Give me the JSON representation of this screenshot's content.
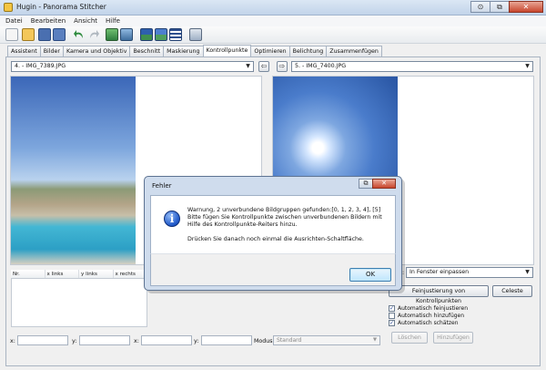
{
  "window": {
    "title": "Hugin - Panorama Stitcher",
    "min_symbol": "⊙",
    "restore_symbol": "⧉",
    "close_symbol": "✕"
  },
  "menu": [
    "Datei",
    "Bearbeiten",
    "Ansicht",
    "Hilfe"
  ],
  "toolbar": {
    "icons": [
      "new-project-icon",
      "open-icon",
      "save-icon",
      "save-as-icon",
      "undo-icon",
      "redo-icon",
      "align-icon",
      "stitch-icon",
      "preview-icon",
      "fast-preview-icon",
      "grid-icon",
      "settings-icon"
    ]
  },
  "tabs": [
    {
      "label": "Assistent",
      "active": false
    },
    {
      "label": "Bilder",
      "active": false
    },
    {
      "label": "Kamera und Objektiv",
      "active": false
    },
    {
      "label": "Beschnitt",
      "active": false
    },
    {
      "label": "Maskierung",
      "active": false
    },
    {
      "label": "Kontrollpunkte",
      "active": true
    },
    {
      "label": "Optimieren",
      "active": false
    },
    {
      "label": "Belichtung",
      "active": false
    },
    {
      "label": "Zusammenfügen",
      "active": false
    }
  ],
  "left_image": {
    "selected": "4. - IMG_7389.JPG",
    "nav": "⇦"
  },
  "right_image": {
    "selected": "5. - IMG_7400.JPG",
    "nav": "⇨"
  },
  "cp_table": {
    "columns": [
      "Nr.",
      "x links",
      "y links",
      "x rechts"
    ]
  },
  "coords": {
    "labels": [
      "x:",
      "y:",
      "x:",
      "y:"
    ],
    "mode_label": "Modus:",
    "mode_value": "Standard"
  },
  "right_controls": {
    "zoom_label_fragment": "om:",
    "zoom_value": "In Fenster einpassen",
    "fine_tune_button": "Feinjustierung von Kontrollpunkten",
    "celeste_button": "Celeste",
    "checks": [
      {
        "label": "Automatisch feinjustieren",
        "checked": true
      },
      {
        "label": "Automatisch hinzufügen",
        "checked": false
      },
      {
        "label": "Automatisch schätzen",
        "checked": true
      }
    ],
    "delete_button": "Löschen",
    "add_button": "Hinzufügen"
  },
  "dialog": {
    "title": "Fehler",
    "icon_glyph": "i",
    "lines": [
      "Warnung, 2 unverbundene Bildgruppen gefunden:[0, 1, 2, 3, 4], [5]",
      "Bitte fügen Sie Kontrollpunkte zwischen unverbundenen Bildern mit",
      "Hilfe des Kontrollpunkte-Reiters hinzu.",
      "Drücken Sie danach noch einmal die Ausrichten-Schaltfläche."
    ],
    "ok_label": "OK",
    "restore_symbol": "⧉",
    "close_symbol": "✕"
  },
  "colors": {
    "titlebar": "#c2d4ea",
    "dialog_frame": "#cfdced",
    "ok_highlight": "#bee6fd"
  }
}
